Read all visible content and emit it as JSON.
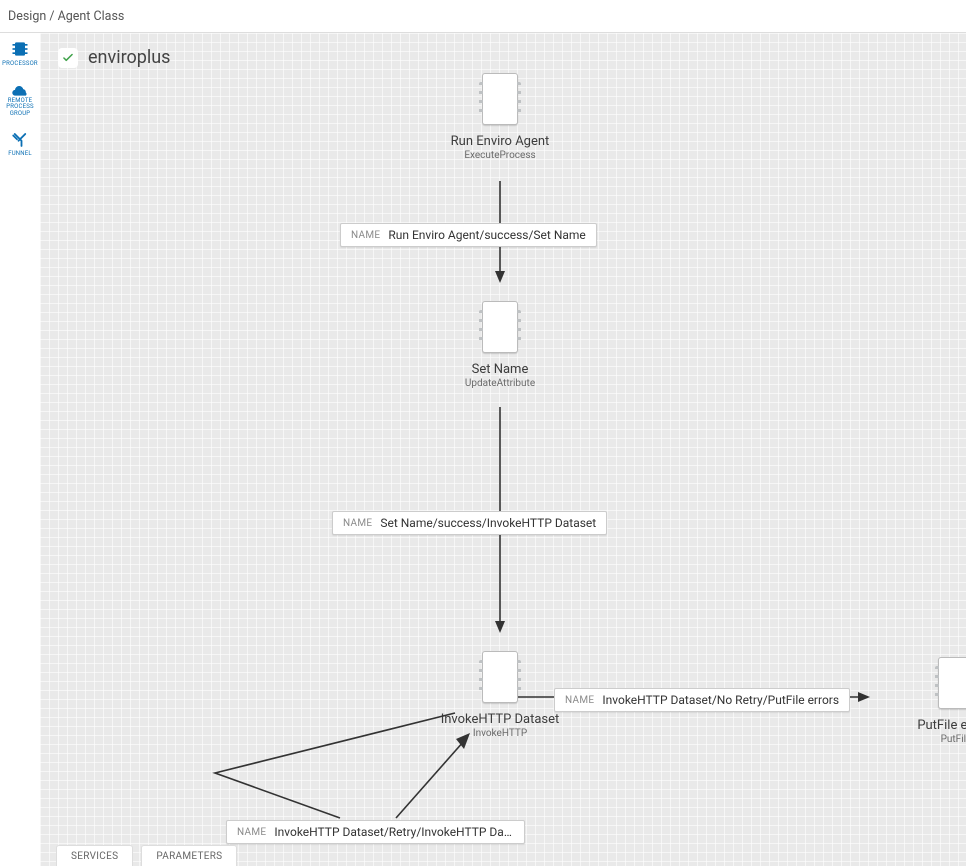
{
  "breadcrumb": "Design / Agent Class",
  "palette": {
    "processor": "PROCESSOR",
    "rpg": "REMOTE\nPROCESS\nGROUP",
    "funnel": "FUNNEL"
  },
  "flow": {
    "title": "enviroplus"
  },
  "nodes": {
    "runEnviro": {
      "title": "Run Enviro Agent",
      "subtitle": "ExecuteProcess"
    },
    "setName": {
      "title": "Set Name",
      "subtitle": "UpdateAttribute"
    },
    "invokeHttp": {
      "title": "InvokeHTTP Dataset",
      "subtitle": "InvokeHTTP"
    },
    "putFile": {
      "title": "PutFile errors",
      "subtitle": "PutFile"
    }
  },
  "connections": {
    "prefix": "NAME",
    "c1": "Run Enviro Agent/success/Set Name",
    "c2": "Set Name/success/InvokeHTTP Dataset",
    "c3": "InvokeHTTP Dataset/No Retry/PutFile errors",
    "c4": "InvokeHTTP Dataset/Retry/InvokeHTTP Datas…"
  },
  "tabs": {
    "services": "SERVICES",
    "parameters": "PARAMETERS"
  }
}
